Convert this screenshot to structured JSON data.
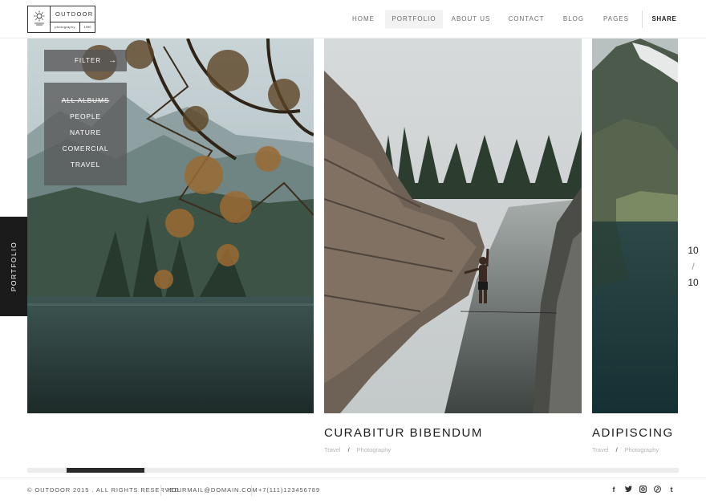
{
  "brand": {
    "name": "OUTDOOR",
    "tagline": "photography",
    "year": "1990"
  },
  "nav": {
    "items": [
      "HOME",
      "PORTFOLIO",
      "ABOUT US",
      "CONTACT",
      "BLOG",
      "PAGES"
    ],
    "active": "PORTFOLIO",
    "share": "SHARE"
  },
  "side_tab": "PORTFOLIO",
  "filter": {
    "label": "FILTER",
    "options": [
      "ALL ALBUMS",
      "PEOPLE",
      "NATURE",
      "COMERCIAL",
      "TRAVEL"
    ],
    "selected": "ALL ALBUMS"
  },
  "slides": [
    {
      "title": "CURABITUR BIBENDUM",
      "category": "Travel",
      "type": "Photography"
    },
    {
      "title": "ADIPISCING ELIT",
      "category": "Travel",
      "type": "Photography"
    }
  ],
  "counter": {
    "current": "10",
    "separator": "/",
    "total": "10"
  },
  "scroll": {
    "position_fraction": 0.06,
    "thumb_fraction": 0.12
  },
  "footer": {
    "copyright": "© OUTDOOR 2015 . ALL RIGHTS RESERVED.",
    "email": "YOURMAIL@DOMAIN.COM",
    "phone": "+7(111)123456789",
    "social_icons": [
      "facebook-icon",
      "twitter-icon",
      "instagram-icon",
      "pinterest-icon",
      "tumblr-icon"
    ],
    "social_glyphs": [
      "f",
      "𝕥",
      "◙",
      "℗",
      "t"
    ]
  }
}
